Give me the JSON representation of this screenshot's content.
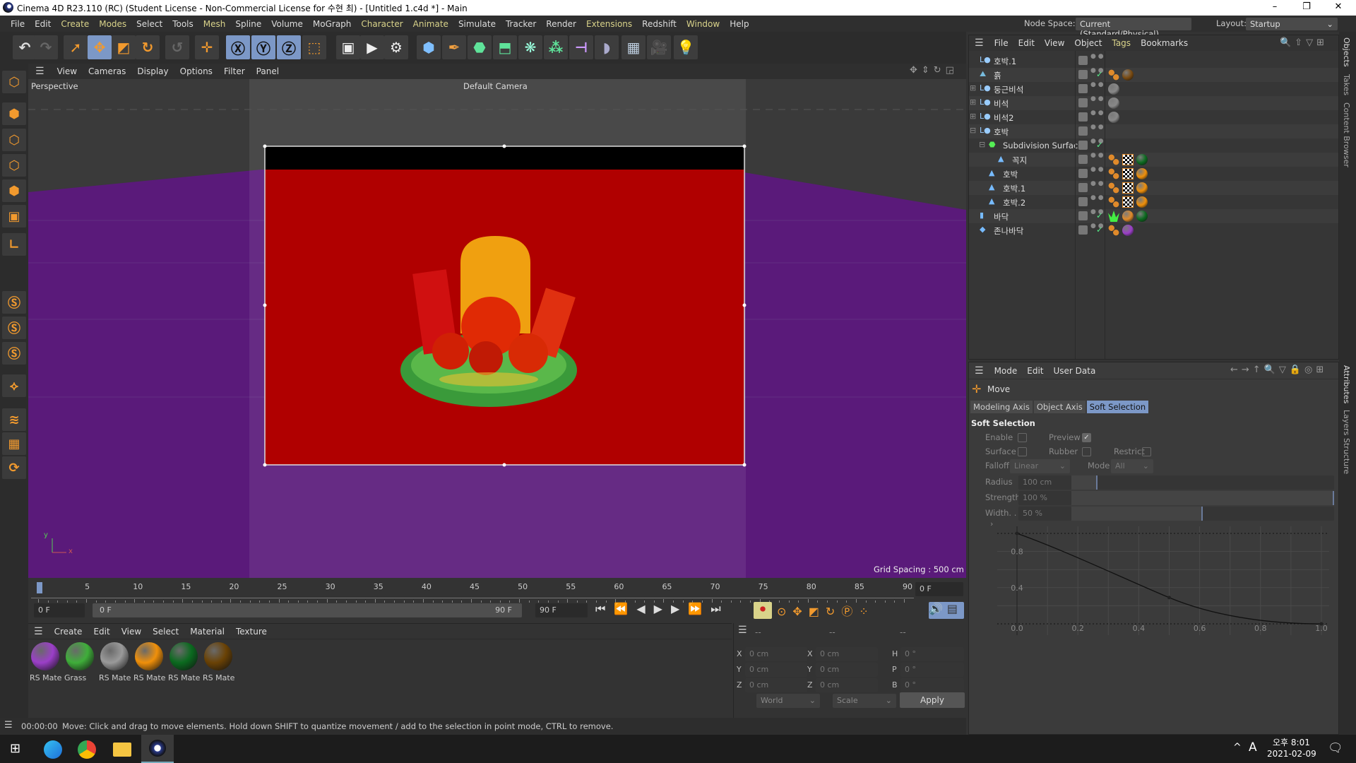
{
  "window": {
    "title": "Cinema 4D R23.110 (RC) (Student License - Non-Commercial License for 수현 최) - [Untitled 1.c4d *] - Main",
    "minimize": "–",
    "restore": "❐",
    "close": "✕"
  },
  "menubar": {
    "items": [
      {
        "label": "File"
      },
      {
        "label": "Edit"
      },
      {
        "label": "Create",
        "y": 1
      },
      {
        "label": "Modes",
        "y": 1
      },
      {
        "label": "Select"
      },
      {
        "label": "Tools"
      },
      {
        "label": "Mesh",
        "y": 1
      },
      {
        "label": "Spline"
      },
      {
        "label": "Volume"
      },
      {
        "label": "MoGraph"
      },
      {
        "label": "Character",
        "y": 1
      },
      {
        "label": "Animate",
        "y": 1
      },
      {
        "label": "Simulate"
      },
      {
        "label": "Tracker"
      },
      {
        "label": "Render"
      },
      {
        "label": "Extensions",
        "y": 1
      },
      {
        "label": "Redshift"
      },
      {
        "label": "Window",
        "y": 1
      },
      {
        "label": "Help"
      }
    ],
    "node_space_label": "Node Space:",
    "node_space_value": "Current (Standard/Physical)",
    "layout_label": "Layout:",
    "layout_value": "Startup"
  },
  "toolbar": {
    "buttons": [
      {
        "icon": "undo-icon",
        "g": "↶",
        "c": "#ddd"
      },
      {
        "icon": "redo-icon",
        "g": "↷",
        "c": "#666"
      },
      {
        "icon": "live-selection-icon",
        "g": "➚",
        "c": "#f29a2e"
      },
      {
        "icon": "move-icon",
        "g": "✥",
        "c": "#f29a2e",
        "on": 1
      },
      {
        "icon": "scale-icon",
        "g": "◩",
        "c": "#f29a2e"
      },
      {
        "icon": "rotate-icon",
        "g": "↻",
        "c": "#f29a2e"
      },
      {
        "icon": "psr-icon",
        "g": "↺",
        "c": "#666"
      },
      {
        "icon": "transform-icon",
        "g": "✛",
        "c": "#f29a2e"
      },
      {
        "icon": "x-axis-icon",
        "g": "Ⓧ",
        "c": "#111",
        "on": 1
      },
      {
        "icon": "y-axis-icon",
        "g": "Ⓨ",
        "c": "#111",
        "on": 1
      },
      {
        "icon": "z-axis-icon",
        "g": "Ⓩ",
        "c": "#111",
        "on": 1
      },
      {
        "icon": "coordinate-system-icon",
        "g": "⬚",
        "c": "#f29a2e"
      },
      {
        "icon": "render-view-icon",
        "g": "▣",
        "c": "#eee"
      },
      {
        "icon": "render-picture-viewer-icon",
        "g": "▶",
        "c": "#eee"
      },
      {
        "icon": "render-settings-icon",
        "g": "⚙",
        "c": "#eee"
      },
      {
        "icon": "cube-icon",
        "g": "⬢",
        "c": "#7fbfff"
      },
      {
        "icon": "pen-spline-icon",
        "g": "✒",
        "c": "#f2a040"
      },
      {
        "icon": "subdivision-surface-icon",
        "g": "⬣",
        "c": "#5fe39a"
      },
      {
        "icon": "extrude-icon",
        "g": "⬒",
        "c": "#5fe39a"
      },
      {
        "icon": "cloner-icon",
        "g": "❋",
        "c": "#9fd"
      },
      {
        "icon": "mograph-icon",
        "g": "⁂",
        "c": "#5fe39a"
      },
      {
        "icon": "deformer-icon",
        "g": "⊣",
        "c": "#c9f"
      },
      {
        "icon": "field-icon",
        "g": "◗",
        "c": "#aac"
      },
      {
        "icon": "floor-icon",
        "g": "▦",
        "c": "#bcd"
      },
      {
        "icon": "camera-icon",
        "g": "🎥",
        "c": "#eee"
      },
      {
        "icon": "light-icon",
        "g": "💡",
        "c": "#eee"
      }
    ]
  },
  "left_toolbar": {
    "buttons": [
      "make-editable-icon",
      "model-mode-icon",
      "points-mode-icon",
      "edges-mode-icon",
      "polygons-mode-icon",
      "uvw-mode-icon",
      "axis-icon",
      "snap-s-icon",
      "snap-s2-icon",
      "snap-s3-icon",
      "magnet-icon",
      "workplane-icon",
      "grid-lock-icon",
      "planar-icon"
    ]
  },
  "viewport": {
    "menu": [
      "View",
      "Cameras",
      "Display",
      "Options",
      "Filter",
      "Panel"
    ],
    "camera_name": "Perspective",
    "active_camera": "Default Camera",
    "grid_spacing": "Grid Spacing : 500 cm",
    "axis_x": "x",
    "axis_y": "y",
    "colors": {
      "floor": "#5a1a7a",
      "render_bg": "#b00000"
    }
  },
  "timeline": {
    "ticks": [
      "0",
      "5",
      "10",
      "15",
      "20",
      "25",
      "30",
      "35",
      "40",
      "45",
      "50",
      "55",
      "60",
      "65",
      "70",
      "75",
      "80",
      "85",
      "90"
    ],
    "current_frame": "0 F",
    "start_frame": "0 F",
    "range_start": "0 F",
    "range_end": "90 F",
    "end_frame": "90 F"
  },
  "material_manager": {
    "menu": [
      "Create",
      "Edit",
      "View",
      "Select",
      "Material",
      "Texture"
    ],
    "materials": [
      {
        "name": "RS Mate",
        "color": "#9b3fc8"
      },
      {
        "name": "Grass",
        "color": "#3fae3a"
      },
      {
        "name": "RS Mate",
        "color": "#9a9a9a"
      },
      {
        "name": "RS Mate",
        "color": "#f0900a"
      },
      {
        "name": "RS Mate",
        "color": "#0b6a1f"
      },
      {
        "name": "RS Mate",
        "color": "#6a4205"
      }
    ]
  },
  "coordinates": {
    "headers": [
      "--",
      "--",
      "--"
    ],
    "rows": [
      {
        "a": "X",
        "av": "0 cm",
        "b": "X",
        "bv": "0 cm",
        "c": "H",
        "cv": "0 °"
      },
      {
        "a": "Y",
        "av": "0 cm",
        "b": "Y",
        "bv": "0 cm",
        "c": "P",
        "cv": "0 °"
      },
      {
        "a": "Z",
        "av": "0 cm",
        "b": "Z",
        "bv": "0 cm",
        "c": "B",
        "cv": "0 °"
      }
    ],
    "space": "World",
    "mode": "Scale",
    "apply": "Apply"
  },
  "status": {
    "time": "00:00:00",
    "message": "Move: Click and drag to move elements. Hold down SHIFT to quantize movement / add to the selection in point mode, CTRL to remove."
  },
  "object_manager": {
    "menu": [
      "File",
      "Edit",
      "View",
      "Object",
      "Tags",
      "Bookmarks"
    ],
    "objects": [
      {
        "name": "호박.1",
        "indent": 1,
        "icon": "null-icon",
        "check": 0,
        "tags": []
      },
      {
        "name": "흙",
        "indent": 1,
        "icon": "landscape-icon",
        "check": 1,
        "tags": [
          "#e08a2a",
          "#7a4a10"
        ]
      },
      {
        "name": "둥근비석",
        "indent": 1,
        "icon": "null-icon",
        "exp": "+",
        "check": 0,
        "tags": [
          "#888"
        ]
      },
      {
        "name": "비석",
        "indent": 1,
        "icon": "null-icon",
        "exp": "+",
        "check": 0,
        "tags": [
          "#888"
        ]
      },
      {
        "name": "비석2",
        "indent": 1,
        "icon": "null-icon",
        "exp": "+",
        "check": 0,
        "tags": [
          "#888"
        ]
      },
      {
        "name": "호박",
        "indent": 1,
        "icon": "null-icon",
        "exp": "−",
        "check": 0,
        "tags": []
      },
      {
        "name": "Subdivision Surface",
        "indent": 2,
        "icon": "subdivision-surface-icon",
        "exp": "−",
        "check": 1,
        "tags": []
      },
      {
        "name": "꼭지",
        "indent": 3,
        "icon": "polygon-object-icon",
        "check": 0,
        "tags": [
          "#e08a2a",
          "checker",
          "#0b6a1f"
        ]
      },
      {
        "name": "호박",
        "indent": 2,
        "icon": "polygon-object-icon",
        "check": 0,
        "tags": [
          "#e08a2a",
          "checker",
          "#f0900a"
        ]
      },
      {
        "name": "호박.1",
        "indent": 2,
        "icon": "polygon-object-icon",
        "check": 0,
        "tags": [
          "#e08a2a",
          "checker",
          "#f0900a"
        ]
      },
      {
        "name": "호박.2",
        "indent": 2,
        "icon": "polygon-object-icon",
        "check": 0,
        "tags": [
          "#e08a2a",
          "checker",
          "#f0900a"
        ]
      },
      {
        "name": "바닥",
        "indent": 1,
        "icon": "cylinder-icon",
        "check": 1,
        "tags": [
          "grass",
          "#e08a2a",
          "#0b6a1f"
        ]
      },
      {
        "name": "존나바닥",
        "indent": 1,
        "icon": "plane-icon",
        "check": 1,
        "tags": [
          "#e08a2a",
          "#9b3fc8"
        ]
      }
    ]
  },
  "attributes": {
    "menu": [
      "Mode",
      "Edit",
      "User Data"
    ],
    "tool_name": "Move",
    "tabs": [
      {
        "label": "Modeling Axis"
      },
      {
        "label": "Object Axis"
      },
      {
        "label": "Soft Selection",
        "active": true
      }
    ],
    "section": "Soft Selection",
    "enable_label": "Enable",
    "enable": false,
    "preview_label": "Preview",
    "preview": true,
    "surface_label": "Surface",
    "surface": false,
    "rubber_label": "Rubber",
    "rubber": false,
    "restrict_label": "Restrict",
    "restrict": false,
    "falloff_label": "Falloff",
    "falloff": "Linear",
    "mode_label": "Mode",
    "mode": "All",
    "radius_label": "Radius",
    "radius": "100 cm",
    "radius_slider": 0.1,
    "strength_label": "Strength",
    "strength": "100 %",
    "strength_slider": 1.0,
    "width_label": "Width. .",
    "width": "50 %",
    "width_slider": 0.5
  },
  "right_tabs": {
    "top": [
      "Objects",
      "Takes",
      "Content Browser"
    ],
    "bottom": [
      "Attributes",
      "Layers",
      "Structure"
    ]
  },
  "taskbar": {
    "time": "오후 8:01",
    "date": "2021-02-09",
    "ime": "A"
  },
  "chart_data": {
    "type": "line",
    "x": [
      0.0,
      0.5,
      1.0
    ],
    "y": [
      1.0,
      0.29,
      0.0
    ],
    "curve": "spline",
    "xticks": [
      "0.0",
      "0.2",
      "0.4",
      "0.6",
      "0.8",
      "1.0"
    ],
    "yticks": [
      "0.8",
      "0.4"
    ],
    "xlim": [
      0,
      1
    ],
    "ylim": [
      0,
      1
    ],
    "grid": true
  }
}
